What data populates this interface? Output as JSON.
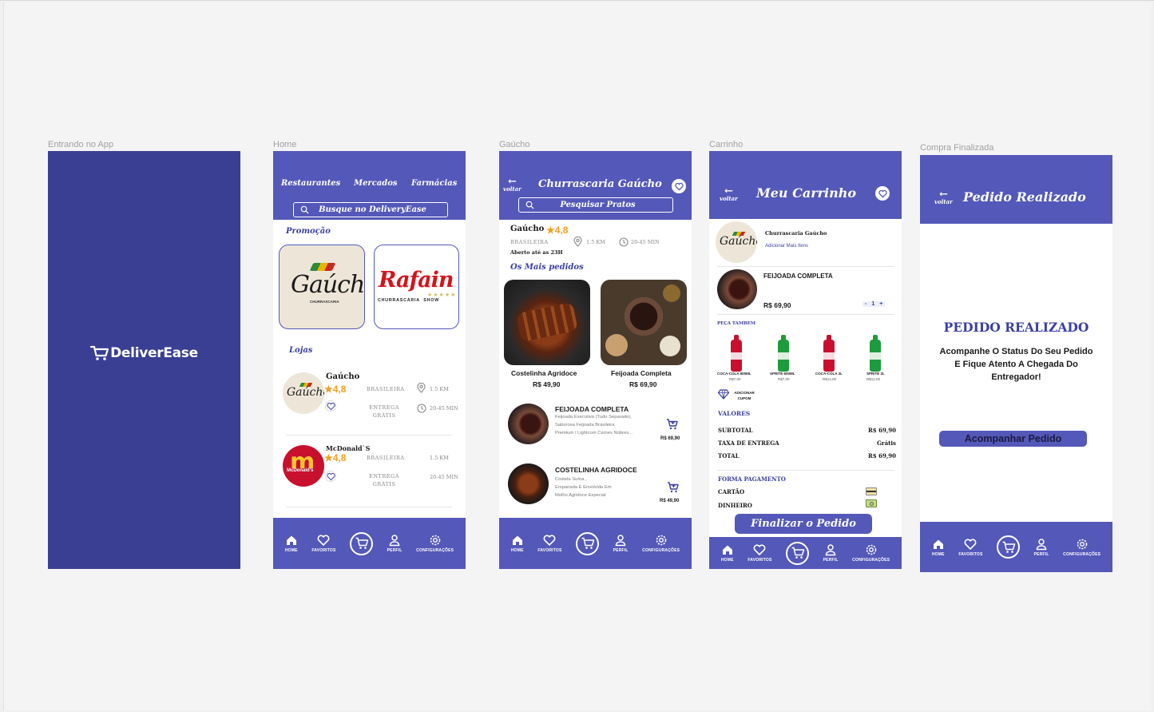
{
  "frames": {
    "splash": {
      "label": "Entrando no App",
      "brand": "DeliverEase"
    },
    "home": {
      "label": "Home",
      "categories": [
        "Restaurantes",
        "Mercados",
        "Farmácias"
      ],
      "search_text": "Busque no DeliveryEase",
      "promo_title": "Promoção",
      "promos": [
        {
          "logo": "Gaúcho",
          "sub": "CHURRASCARIA"
        },
        {
          "logo": "Rafain",
          "sub": "CHURRASCARIA  SHOW"
        }
      ],
      "stores_title": "Lojas",
      "stores": [
        {
          "name": "Gaúcho",
          "rating": "4,8",
          "cuisine": "BRASILEIRA",
          "distance": "1.5 KM",
          "delivery": "ENTREGA GRÁTIS",
          "time": "20-45 MIN"
        },
        {
          "name": "McDonald`S",
          "rating": "4,8",
          "cuisine": "BRASILEIRA",
          "distance": "1.5 KM",
          "delivery": "ENTREGA GRÁTIS",
          "time": "20-45 MIN",
          "logo_text": "McDonald's"
        }
      ]
    },
    "store": {
      "label": "Gaúcho",
      "back": "voltar",
      "title": "Churrascaria Gaúcho",
      "search_text": "Pesquisar Pratos",
      "name": "Gaúcho",
      "rating": "4,8",
      "cuisine": "BRASILEIRA",
      "distance": "1.5 KM",
      "time": "20-45 MIN",
      "hours": "Aberto até as 23H",
      "popular_title": "Os Mais pedidos",
      "popular": [
        {
          "name": "Costelinha Agridoce",
          "price": "R$ 49,90"
        },
        {
          "name": "Feijoada Completa",
          "price": "R$ 69,90"
        }
      ],
      "items": [
        {
          "name": "FEIJOADA COMPLETA",
          "desc": [
            "Feijoada Executiva (Tudo Separado),",
            "Saborosa Feijoada Brasileira",
            "Premium / Lightcom Carnes Nobres..."
          ],
          "price": "R$ 69,90"
        },
        {
          "name": "COSTELINHA AGRIDOCE",
          "desc": [
            "Costela Suína ,",
            "Empanada E Envolvida Em",
            "Molho Agridoce Especial"
          ],
          "price": "R$ 49,90"
        }
      ]
    },
    "cart": {
      "label": "Carrinho",
      "back": "voltar",
      "title": "Meu Carrinho",
      "store_name": "Churrascaria Gaúcho",
      "add_more": "Adicionar Mais Itens",
      "item_name": "FEIJOADA COMPLETA",
      "item_price": "R$ 69,90",
      "qty_minus": "-",
      "qty": "1",
      "qty_plus": "+",
      "also_title": "PEÇA TAMBEM",
      "drinks": [
        {
          "name": "COCA-COLA 600ML",
          "price": "R$7,00",
          "color": "#c8102e"
        },
        {
          "name": "SPRITE 600ML",
          "price": "R$7,00",
          "color": "#1e9b3c"
        },
        {
          "name": "COCA-COLA 2L",
          "price": "R$14,00",
          "color": "#c8102e"
        },
        {
          "name": "SPRITE 2L",
          "price": "R$12,00",
          "color": "#1e9b3c"
        }
      ],
      "coupon": "ADICIONAR CUPOM",
      "values_title": "VALORES",
      "values": [
        {
          "label": "SUBTOTAL",
          "value": "R$ 69,90"
        },
        {
          "label": "TAXA DE ENTREGA",
          "value": "Grátis"
        },
        {
          "label": "TOTAL",
          "value": "R$ 69,90"
        }
      ],
      "payment_title": "FORMA PAGAMENTO",
      "payments": [
        "CARTÃO",
        "DINHEIRO"
      ],
      "finalize": "Finalizar o Pedido"
    },
    "done": {
      "label": "Compra Finalizada",
      "back": "voltar",
      "title": "Pedido Realizado",
      "heading": "PEDIDO REALIZADO",
      "message": [
        "Acompanhe O Status Do Seu Pedido",
        "E Fique Atento A Chegada Do",
        "Entregador!"
      ],
      "button": "Acompanhar Pedido"
    }
  },
  "nav": {
    "home": "HOME",
    "favorites": "FAVORITOS",
    "profile": "PERFIL",
    "settings": "CONFIGURAÇÕES"
  },
  "colors": {
    "primary": "#5458b8",
    "splash": "#3a3f94",
    "accent_text": "#3b3fa0",
    "star": "#f0a020",
    "muted": "#888888"
  }
}
